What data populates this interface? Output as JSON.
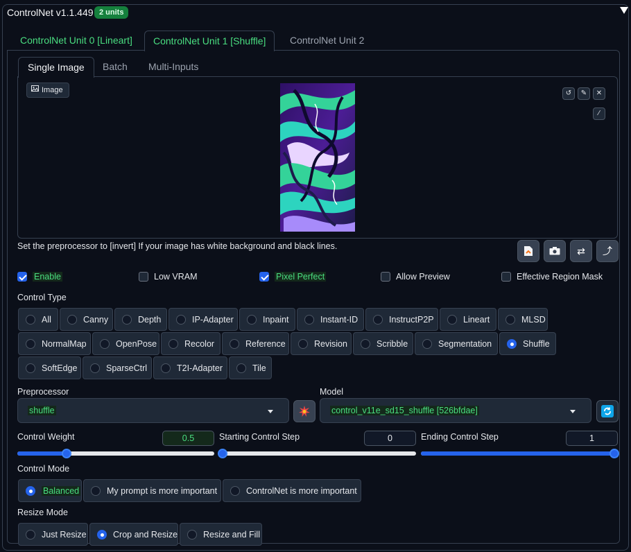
{
  "header": {
    "title": "ControlNet v1.1.449",
    "badge": "2 units"
  },
  "unit_tabs": [
    "ControlNet Unit 0 [Lineart]",
    "ControlNet Unit 1 [Shuffle]",
    "ControlNet Unit 2"
  ],
  "input_tabs": [
    "Single Image",
    "Batch",
    "Multi-Inputs"
  ],
  "image_label": "Image",
  "hint": "Set the preprocessor to [invert] If your image has white background and black lines.",
  "options": {
    "enable": {
      "label": "Enable",
      "checked": true
    },
    "low_vram": {
      "label": "Low VRAM",
      "checked": false
    },
    "pixel_perfect": {
      "label": "Pixel Perfect",
      "checked": true
    },
    "allow_preview": {
      "label": "Allow Preview",
      "checked": false
    },
    "effective_region_mask": {
      "label": "Effective Region Mask",
      "checked": false
    }
  },
  "control_type": {
    "label": "Control Type",
    "selected": "Shuffle",
    "items": [
      "All",
      "Canny",
      "Depth",
      "IP-Adapter",
      "Inpaint",
      "Instant-ID",
      "InstructP2P",
      "Lineart",
      "MLSD",
      "NormalMap",
      "OpenPose",
      "Recolor",
      "Reference",
      "Revision",
      "Scribble",
      "Segmentation",
      "Shuffle",
      "SoftEdge",
      "SparseCtrl",
      "T2I-Adapter",
      "Tile"
    ]
  },
  "preprocessor": {
    "label": "Preprocessor",
    "value": "shuffle"
  },
  "model": {
    "label": "Model",
    "value": "control_v11e_sd15_shuffle [526bfdae]"
  },
  "control_weight": {
    "label": "Control Weight",
    "value": "0.5",
    "fraction": 0.25
  },
  "starting_step": {
    "label": "Starting Control Step",
    "value": "0",
    "fraction": 0.0
  },
  "ending_step": {
    "label": "Ending Control Step",
    "value": "1",
    "fraction": 1.0
  },
  "control_mode": {
    "label": "Control Mode",
    "items": [
      "Balanced",
      "My prompt is more important",
      "ControlNet is more important"
    ],
    "selected": "Balanced"
  },
  "resize_mode": {
    "label": "Resize Mode",
    "items": [
      "Just Resize",
      "Crop and Resize",
      "Resize and Fill"
    ],
    "selected": "Crop and Resize"
  },
  "colors": {
    "accent": "#2563eb",
    "green_text": "#4ade80",
    "panel_bg": "#0b0f19",
    "control_bg": "#1f2937",
    "border": "#374151"
  }
}
